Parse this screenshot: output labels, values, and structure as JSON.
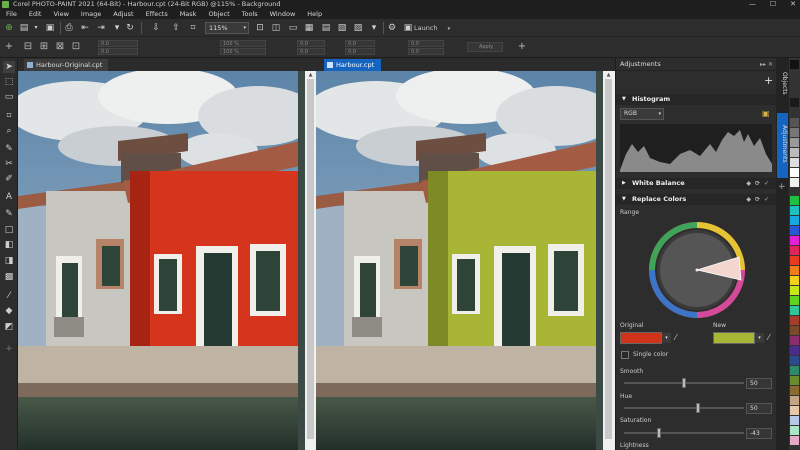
{
  "titlebar": {
    "title": "Corel PHOTO-PAINT 2021 (64-Bit) - Harbour.cpt (24-Bit RGB) @115% - Background",
    "min": "—",
    "max": "☐",
    "close": "✕"
  },
  "menu": [
    "File",
    "Edit",
    "View",
    "Image",
    "Adjust",
    "Effects",
    "Mask",
    "Object",
    "Tools",
    "Window",
    "Help"
  ],
  "toolbar": {
    "zoom": "115%",
    "launch": "Launch"
  },
  "propbar": {
    "f1": "0.0",
    "f2": "0.0",
    "f3": "100 %",
    "f4": "100 %",
    "f5": "0.0",
    "f6": "0.0",
    "f7": "0.0",
    "f8": "0.0",
    "f9": "0.0",
    "f10": "0.0",
    "f11": "Apply"
  },
  "tabs": {
    "left": "Harbour-Original.cpt",
    "right": "Harbour.cpt"
  },
  "panel": {
    "title": "Adjustments",
    "histogram": {
      "title": "Histogram",
      "channel": "RGB"
    },
    "white_balance": {
      "title": "White Balance"
    },
    "replace_colors": {
      "title": "Replace Colors",
      "range_label": "Range",
      "original_label": "Original",
      "new_label": "New",
      "single_color": "Single color",
      "smooth_label": "Smooth",
      "smooth_value": "50",
      "hue_label": "Hue",
      "hue_value": "50",
      "saturation_label": "Saturation",
      "saturation_value": "-43",
      "lightness_label": "Lightness"
    }
  },
  "side_tabs": {
    "objects": "Objects",
    "adjustments": "Adjustments"
  },
  "colors": {
    "original": "#d0321a",
    "new": "#a9b535",
    "accent": "#1565c0"
  }
}
